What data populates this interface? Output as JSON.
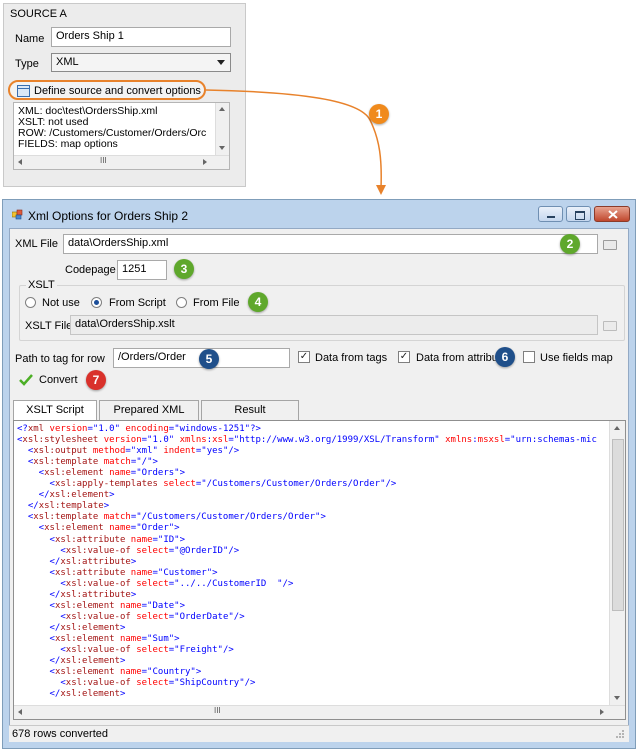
{
  "source_panel": {
    "title": "SOURCE A",
    "name_label": "Name",
    "name_value": "Orders Ship 1",
    "type_label": "Type",
    "type_value": "XML",
    "define_button": "Define source and convert options",
    "info_lines": [
      "XML: doc\\test\\OrdersShip.xml",
      "XSLT: not used",
      "ROW: /Customers/Customer/Orders/Orc",
      "FIELDS: map options"
    ],
    "scroll_grip": "III"
  },
  "callouts": [
    "1",
    "2",
    "3",
    "4",
    "5",
    "6",
    "7"
  ],
  "colors": {
    "callout_orange": "#f08a1c",
    "callout_green": "#5fa82c",
    "callout_blue": "#1f4f8a",
    "callout_red": "#d9312b",
    "highlight_orange": "#e8822b",
    "title_bar": "#bcd3ec"
  },
  "dialog": {
    "title": "Xml Options for Orders Ship 2",
    "xml_file_label": "XML File",
    "xml_file_value": "data\\OrdersShip.xml",
    "codepage_label": "Codepage",
    "codepage_value": "1251",
    "xslt_group_label": "XSLT",
    "radio_not_use": "Not use",
    "radio_from_script": "From Script",
    "radio_from_file": "From File",
    "xslt_file_label": "XSLT File",
    "xslt_file_value": "data\\OrdersShip.xslt",
    "path_label": "Path to tag for row",
    "path_value": "/Orders/Order",
    "chk_data_from_tags": "Data from tags",
    "chk_data_from_attributes": "Data from attribu",
    "chk_use_fields_map": "Use fields map",
    "convert_button": "Convert",
    "tabs": [
      "XSLT Script",
      "Prepared XML",
      "Result"
    ],
    "status": "678 rows converted",
    "scroll_grip": "III"
  },
  "code_lines": [
    [
      {
        "c": "p",
        "t": "<?"
      },
      {
        "c": "k",
        "t": "xml"
      },
      {
        "c": "a",
        "t": " version"
      },
      {
        "c": "p",
        "t": "=\""
      },
      {
        "c": "v",
        "t": "1.0"
      },
      {
        "c": "p",
        "t": "\""
      },
      {
        "c": "a",
        "t": " encoding"
      },
      {
        "c": "p",
        "t": "=\""
      },
      {
        "c": "v",
        "t": "windows-1251"
      },
      {
        "c": "p",
        "t": "\"?>"
      }
    ],
    [
      {
        "c": "p",
        "t": "<"
      },
      {
        "c": "k",
        "t": "xsl:stylesheet"
      },
      {
        "c": "a",
        "t": " version"
      },
      {
        "c": "p",
        "t": "=\""
      },
      {
        "c": "v",
        "t": "1.0"
      },
      {
        "c": "p",
        "t": "\""
      },
      {
        "c": "a",
        "t": " xmlns"
      },
      {
        "c": "p",
        "t": ":"
      },
      {
        "c": "a",
        "t": "xsl"
      },
      {
        "c": "p",
        "t": "=\""
      },
      {
        "c": "v",
        "t": "http://www.w3.org/1999/XSL/Transform"
      },
      {
        "c": "p",
        "t": "\""
      },
      {
        "c": "a",
        "t": " xmlns"
      },
      {
        "c": "p",
        "t": ":"
      },
      {
        "c": "a",
        "t": "msxsl"
      },
      {
        "c": "p",
        "t": "=\""
      },
      {
        "c": "v",
        "t": "urn:schemas-mic"
      }
    ],
    [
      {
        "c": "p",
        "t": "  <"
      },
      {
        "c": "k",
        "t": "xsl:output"
      },
      {
        "c": "a",
        "t": " method"
      },
      {
        "c": "p",
        "t": "=\""
      },
      {
        "c": "v",
        "t": "xml"
      },
      {
        "c": "p",
        "t": "\""
      },
      {
        "c": "a",
        "t": " indent"
      },
      {
        "c": "p",
        "t": "=\""
      },
      {
        "c": "v",
        "t": "yes"
      },
      {
        "c": "p",
        "t": "\"/>"
      }
    ],
    [
      {
        "c": "p",
        "t": "  <"
      },
      {
        "c": "k",
        "t": "xsl:template"
      },
      {
        "c": "a",
        "t": " match"
      },
      {
        "c": "p",
        "t": "=\""
      },
      {
        "c": "v",
        "t": "/"
      },
      {
        "c": "p",
        "t": "\">"
      }
    ],
    [
      {
        "c": "p",
        "t": "    <"
      },
      {
        "c": "k",
        "t": "xsl:element"
      },
      {
        "c": "a",
        "t": " name"
      },
      {
        "c": "p",
        "t": "=\""
      },
      {
        "c": "v",
        "t": "Orders"
      },
      {
        "c": "p",
        "t": "\">"
      }
    ],
    [
      {
        "c": "p",
        "t": "      <"
      },
      {
        "c": "k",
        "t": "xsl:apply-templates"
      },
      {
        "c": "a",
        "t": " select"
      },
      {
        "c": "p",
        "t": "=\""
      },
      {
        "c": "v",
        "t": "/Customers/Customer/Orders/Order"
      },
      {
        "c": "p",
        "t": "\"/>"
      }
    ],
    [
      {
        "c": "p",
        "t": "    </"
      },
      {
        "c": "k",
        "t": "xsl:element"
      },
      {
        "c": "p",
        "t": ">"
      }
    ],
    [
      {
        "c": "p",
        "t": "  </"
      },
      {
        "c": "k",
        "t": "xsl:template"
      },
      {
        "c": "p",
        "t": ">"
      }
    ],
    [
      {
        "c": "p",
        "t": "  <"
      },
      {
        "c": "k",
        "t": "xsl:template"
      },
      {
        "c": "a",
        "t": " match"
      },
      {
        "c": "p",
        "t": "=\""
      },
      {
        "c": "v",
        "t": "/Customers/Customer/Orders/Order"
      },
      {
        "c": "p",
        "t": "\">"
      }
    ],
    [
      {
        "c": "p",
        "t": "    <"
      },
      {
        "c": "k",
        "t": "xsl:element"
      },
      {
        "c": "a",
        "t": " name"
      },
      {
        "c": "p",
        "t": "=\""
      },
      {
        "c": "v",
        "t": "Order"
      },
      {
        "c": "p",
        "t": "\">"
      }
    ],
    [
      {
        "c": "p",
        "t": "      <"
      },
      {
        "c": "k",
        "t": "xsl:attribute"
      },
      {
        "c": "a",
        "t": " name"
      },
      {
        "c": "p",
        "t": "=\""
      },
      {
        "c": "v",
        "t": "ID"
      },
      {
        "c": "p",
        "t": "\">"
      }
    ],
    [
      {
        "c": "p",
        "t": "        <"
      },
      {
        "c": "k",
        "t": "xsl:value-of"
      },
      {
        "c": "a",
        "t": " select"
      },
      {
        "c": "p",
        "t": "=\""
      },
      {
        "c": "v",
        "t": "@OrderID"
      },
      {
        "c": "p",
        "t": "\"/>"
      }
    ],
    [
      {
        "c": "p",
        "t": "      </"
      },
      {
        "c": "k",
        "t": "xsl:attribute"
      },
      {
        "c": "p",
        "t": ">"
      }
    ],
    [
      {
        "c": "p",
        "t": "      <"
      },
      {
        "c": "k",
        "t": "xsl:attribute"
      },
      {
        "c": "a",
        "t": " name"
      },
      {
        "c": "p",
        "t": "=\""
      },
      {
        "c": "v",
        "t": "Customer"
      },
      {
        "c": "p",
        "t": "\">"
      }
    ],
    [
      {
        "c": "p",
        "t": "        <"
      },
      {
        "c": "k",
        "t": "xsl:value-of"
      },
      {
        "c": "a",
        "t": " select"
      },
      {
        "c": "p",
        "t": "=\""
      },
      {
        "c": "v",
        "t": "../../CustomerID  "
      },
      {
        "c": "p",
        "t": "\"/>"
      }
    ],
    [
      {
        "c": "p",
        "t": "      </"
      },
      {
        "c": "k",
        "t": "xsl:attribute"
      },
      {
        "c": "p",
        "t": ">"
      }
    ],
    [
      {
        "c": "p",
        "t": "      <"
      },
      {
        "c": "k",
        "t": "xsl:element"
      },
      {
        "c": "a",
        "t": " name"
      },
      {
        "c": "p",
        "t": "=\""
      },
      {
        "c": "v",
        "t": "Date"
      },
      {
        "c": "p",
        "t": "\">"
      }
    ],
    [
      {
        "c": "p",
        "t": "        <"
      },
      {
        "c": "k",
        "t": "xsl:value-of"
      },
      {
        "c": "a",
        "t": " select"
      },
      {
        "c": "p",
        "t": "=\""
      },
      {
        "c": "v",
        "t": "OrderDate"
      },
      {
        "c": "p",
        "t": "\"/>"
      }
    ],
    [
      {
        "c": "p",
        "t": "      </"
      },
      {
        "c": "k",
        "t": "xsl:element"
      },
      {
        "c": "p",
        "t": ">"
      }
    ],
    [
      {
        "c": "p",
        "t": "      <"
      },
      {
        "c": "k",
        "t": "xsl:element"
      },
      {
        "c": "a",
        "t": " name"
      },
      {
        "c": "p",
        "t": "=\""
      },
      {
        "c": "v",
        "t": "Sum"
      },
      {
        "c": "p",
        "t": "\">"
      }
    ],
    [
      {
        "c": "p",
        "t": "        <"
      },
      {
        "c": "k",
        "t": "xsl:value-of"
      },
      {
        "c": "a",
        "t": " select"
      },
      {
        "c": "p",
        "t": "=\""
      },
      {
        "c": "v",
        "t": "Freight"
      },
      {
        "c": "p",
        "t": "\"/>"
      }
    ],
    [
      {
        "c": "p",
        "t": "      </"
      },
      {
        "c": "k",
        "t": "xsl:element"
      },
      {
        "c": "p",
        "t": ">"
      }
    ],
    [
      {
        "c": "p",
        "t": "      <"
      },
      {
        "c": "k",
        "t": "xsl:element"
      },
      {
        "c": "a",
        "t": " name"
      },
      {
        "c": "p",
        "t": "=\""
      },
      {
        "c": "v",
        "t": "Country"
      },
      {
        "c": "p",
        "t": "\">"
      }
    ],
    [
      {
        "c": "p",
        "t": "        <"
      },
      {
        "c": "k",
        "t": "xsl:value-of"
      },
      {
        "c": "a",
        "t": " select"
      },
      {
        "c": "p",
        "t": "=\""
      },
      {
        "c": "v",
        "t": "ShipCountry"
      },
      {
        "c": "p",
        "t": "\"/>"
      }
    ],
    [
      {
        "c": "p",
        "t": "      </"
      },
      {
        "c": "k",
        "t": "xsl:element"
      },
      {
        "c": "p",
        "t": ">"
      }
    ]
  ]
}
